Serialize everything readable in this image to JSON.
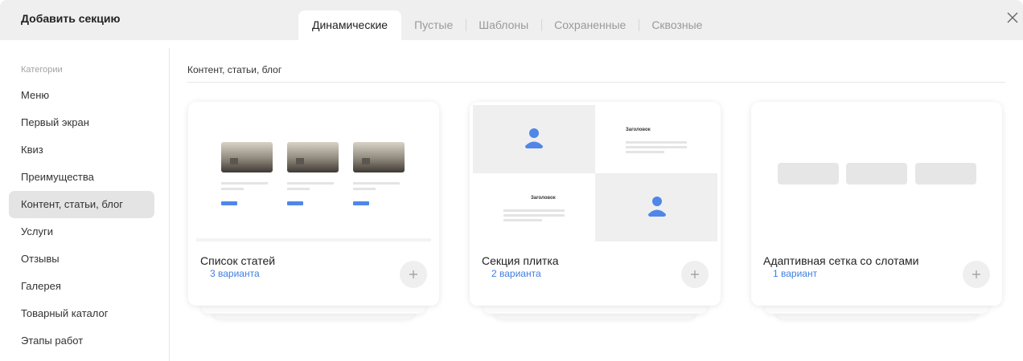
{
  "header": {
    "title": "Добавить секцию",
    "tabs": [
      {
        "label": "Динамические",
        "active": true
      },
      {
        "label": "Пустые",
        "active": false
      },
      {
        "label": "Шаблоны",
        "active": false
      },
      {
        "label": "Сохраненные",
        "active": false
      },
      {
        "label": "Сквозные",
        "active": false
      }
    ],
    "close_icon": "close-icon"
  },
  "sidebar": {
    "heading": "Категории",
    "items": [
      {
        "label": "Меню",
        "active": false
      },
      {
        "label": "Первый экран",
        "active": false
      },
      {
        "label": "Квиз",
        "active": false
      },
      {
        "label": "Преимущества",
        "active": false
      },
      {
        "label": "Контент, статьи, блог",
        "active": true
      },
      {
        "label": "Услуги",
        "active": false
      },
      {
        "label": "Отзывы",
        "active": false
      },
      {
        "label": "Галерея",
        "active": false
      },
      {
        "label": "Товарный каталог",
        "active": false
      },
      {
        "label": "Этапы работ",
        "active": false
      }
    ]
  },
  "main": {
    "section_title": "Контент, статьи, блог",
    "cards": [
      {
        "name": "Список статей",
        "count": "3 варианта",
        "add_icon": "plus-icon"
      },
      {
        "name": "Секция плитка",
        "count": "2 варианта",
        "add_icon": "plus-icon",
        "preview_heading": "Заголовок"
      },
      {
        "name": "Адаптивная сетка со слотами",
        "count": "1 вариант",
        "add_icon": "plus-icon"
      }
    ]
  },
  "colors": {
    "accent": "#3f7fe0",
    "icon_blue": "#4f86e8",
    "topbar": "#efefef",
    "active_bg": "#e4e4e4"
  }
}
